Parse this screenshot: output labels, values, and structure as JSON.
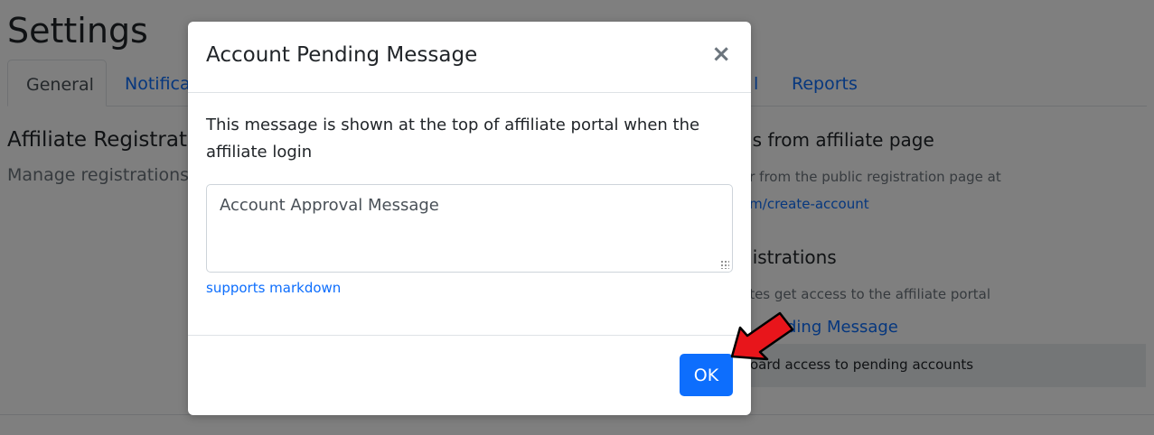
{
  "page": {
    "title": "Settings",
    "tabs": [
      {
        "label": "General",
        "active": true
      },
      {
        "label": "Notifica"
      },
      {
        "label": "l"
      },
      {
        "label": "Reports"
      }
    ],
    "left_section": {
      "title": "Affiliate Registratio",
      "subtitle": "Manage registrations o"
    },
    "right_section": {
      "title1": "ns from affiliate page",
      "text1": "er from the public registration page at",
      "link1": "om/create-account",
      "title2": "gistrations",
      "text2": "ates get access to the affiliate portal",
      "link2": "ding Message",
      "row_text": "oard access to pending accounts"
    }
  },
  "modal": {
    "title": "Account Pending Message",
    "close_symbol": "×",
    "description": "This message is shown at the top of affiliate portal when the affiliate login",
    "textarea_value": "Account Approval Message",
    "hint": "supports markdown",
    "ok_label": "OK"
  },
  "colors": {
    "primary": "#0d6efd",
    "backdrop": "rgba(0,0,0,0.5)",
    "arrow": "#e8151b"
  },
  "icons": {
    "close": "close-icon",
    "resize": "resize-grip-icon",
    "annotation": "red-arrow-icon"
  }
}
